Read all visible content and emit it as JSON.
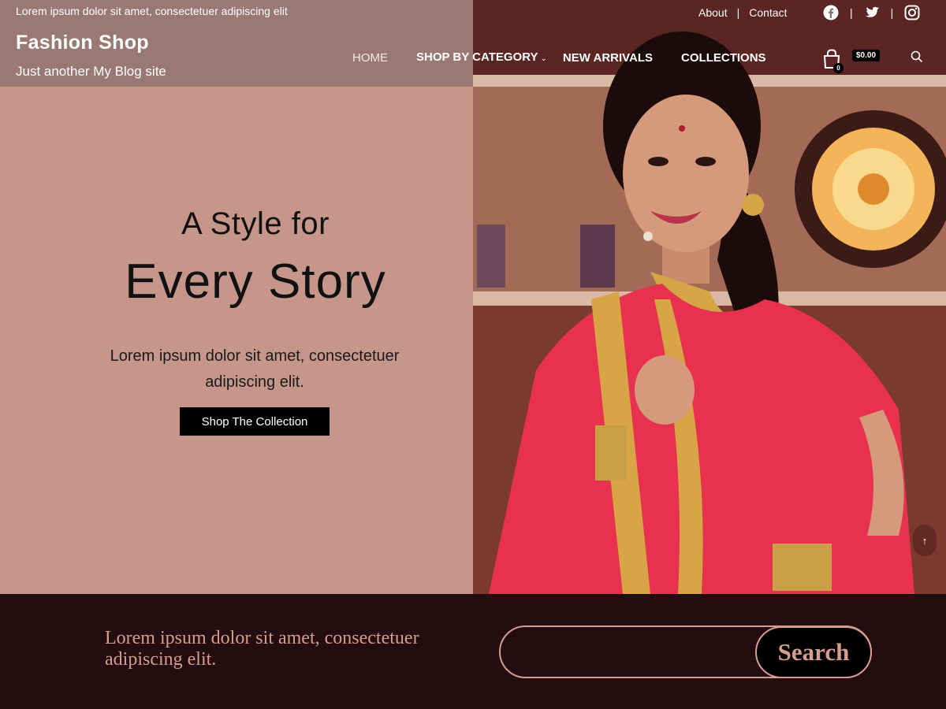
{
  "header": {
    "topbar_text": "Lorem ipsum dolor sit amet, consectetuer adipiscing elit",
    "site_title": "Fashion Shop",
    "tagline": "Just another My Blog site",
    "top_links": [
      "About",
      "Contact"
    ],
    "social_icons": [
      "facebook-icon",
      "twitter-icon",
      "instagram-icon"
    ],
    "nav": [
      {
        "label": "HOME",
        "has_dropdown": false
      },
      {
        "label": "SHOP BY CATEGORY",
        "has_dropdown": true
      },
      {
        "label": "NEW ARRIVALS",
        "has_dropdown": false
      },
      {
        "label": "COLLECTIONS",
        "has_dropdown": false
      }
    ],
    "cart": {
      "count": "0",
      "total": "$0.00"
    },
    "search_icon": "search-icon"
  },
  "hero": {
    "subtitle": "A Style for",
    "title": "Every Story",
    "description": "Lorem ipsum dolor sit amet, consectetuer adipiscing elit.",
    "button_label": "Shop The Collection"
  },
  "footer_band": {
    "text": "Lorem ipsum dolor sit amet, consectetuer adipiscing elit.",
    "search_placeholder": "",
    "search_button": "Search"
  },
  "scroll_top": "↑",
  "colors": {
    "hero_left_bg": "#c7968a",
    "header_overlay": "#9a7874",
    "band_bg": "#230d10",
    "accent": "#d69c8c"
  }
}
